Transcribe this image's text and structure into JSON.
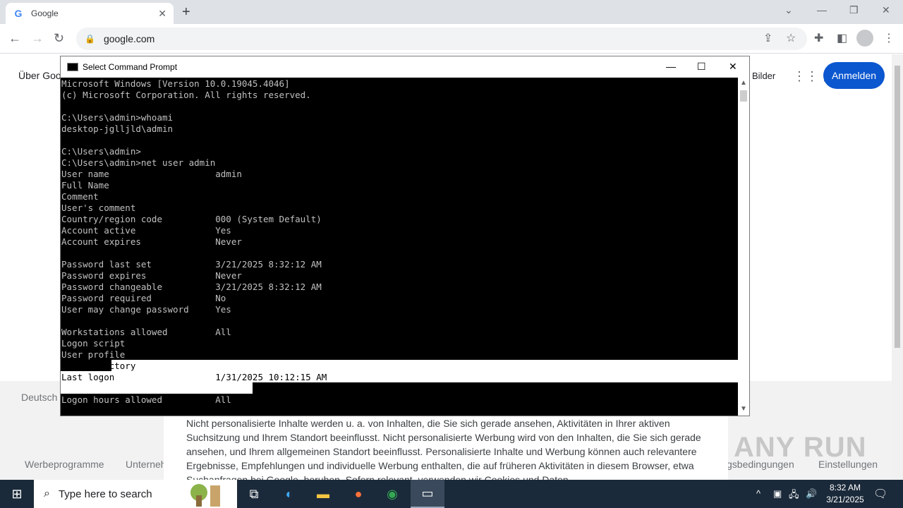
{
  "browser": {
    "tab_title": "Google",
    "tab_favicon": "G",
    "url": "google.com"
  },
  "google": {
    "about_link": "Über Goo",
    "images_link": "Bilder",
    "signin_button": "Anmelden",
    "region": "Deutsch",
    "footer_links": [
      "Werbeprogramme",
      "Unternehm",
      "gsbedingungen",
      "Einstellungen"
    ],
    "consent_text": "Nicht personalisierte Inhalte werden u. a. von Inhalten, die Sie sich gerade ansehen, Aktivitäten in Ihrer aktiven Suchsitzung und Ihrem Standort beeinflusst. Nicht personalisierte Werbung wird von den Inhalten, die Sie sich gerade ansehen, und Ihrem allgemeinen Standort beeinflusst. Personalisierte Inhalte und Werbung können auch relevantere Ergebnisse, Empfehlungen und individuelle Werbung enthalten, die auf früheren Aktivitäten in diesem Browser, etwa Suchanfragen bei Google, beruhen. Sofern relevant, verwenden wir Cookies und Daten",
    "watermark": "ANY RUN"
  },
  "cmd": {
    "title": "Select Command Prompt",
    "lines": [
      "Microsoft Windows [Version 10.0.19045.4046]",
      "(c) Microsoft Corporation. All rights reserved.",
      "",
      "C:\\Users\\admin>whoami",
      "desktop-jglljld\\admin",
      "",
      "C:\\Users\\admin>",
      "C:\\Users\\admin>net user admin",
      "User name                    admin",
      "Full Name",
      "Comment",
      "User's comment",
      "Country/region code          000 (System Default)",
      "Account active               Yes",
      "Account expires              Never",
      "",
      "Password last set            3/21/2025 8:32:12 AM",
      "Password expires             Never",
      "Password changeable          3/21/2025 8:32:12 AM",
      "Password required            No",
      "User may change password     Yes",
      "",
      "Workstations allowed         All",
      "Logon script",
      "User profile",
      "Home directory",
      "Last logon                   1/31/2025 10:12:15 AM",
      "",
      "Logon hours allowed          All"
    ]
  },
  "taskbar": {
    "search_placeholder": "Type here to search",
    "time": "8:32 AM",
    "date": "3/21/2025"
  }
}
